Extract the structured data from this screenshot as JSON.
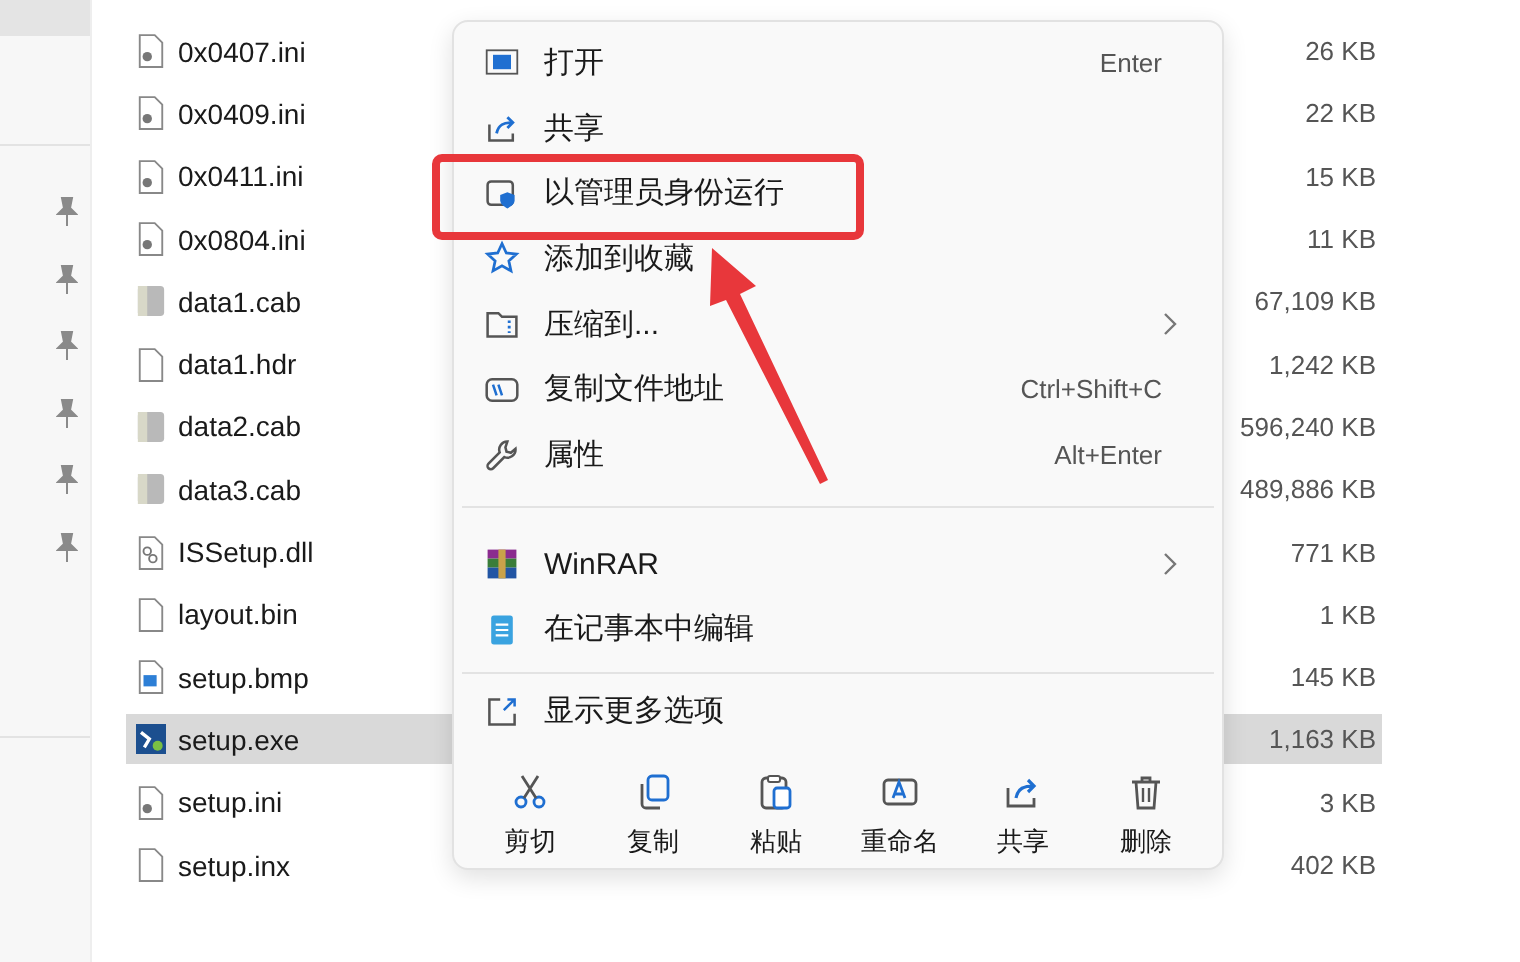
{
  "navigation_pane": {
    "pinned_items": [
      {
        "pinned": true
      },
      {
        "pinned": true
      },
      {
        "pinned": true
      },
      {
        "pinned": true
      },
      {
        "pinned": true
      },
      {
        "pinned": true
      }
    ]
  },
  "files": [
    {
      "name": "0x0407.ini",
      "size": "26 KB",
      "kind": "ini",
      "selected": false
    },
    {
      "name": "0x0409.ini",
      "size": "22 KB",
      "kind": "ini",
      "selected": false
    },
    {
      "name": "0x0411.ini",
      "size": "15 KB",
      "kind": "ini",
      "selected": false
    },
    {
      "name": "0x0804.ini",
      "size": "11 KB",
      "kind": "ini",
      "selected": false
    },
    {
      "name": "data1.cab",
      "size": "67,109 KB",
      "kind": "cab",
      "selected": false
    },
    {
      "name": "data1.hdr",
      "size": "1,242 KB",
      "kind": "blank",
      "selected": false
    },
    {
      "name": "data2.cab",
      "size": "596,240 KB",
      "kind": "cab",
      "selected": false
    },
    {
      "name": "data3.cab",
      "size": "489,886 KB",
      "kind": "cab",
      "selected": false
    },
    {
      "name": "ISSetup.dll",
      "size": "771 KB",
      "kind": "dll",
      "selected": false
    },
    {
      "name": "layout.bin",
      "size": "1 KB",
      "kind": "blank",
      "selected": false
    },
    {
      "name": "setup.bmp",
      "size": "145 KB",
      "kind": "bmp",
      "selected": false
    },
    {
      "name": "setup.exe",
      "size": "1,163 KB",
      "kind": "exe",
      "selected": true
    },
    {
      "name": "setup.ini",
      "size": "3 KB",
      "kind": "ini",
      "selected": false
    },
    {
      "name": "setup.inx",
      "size": "402 KB",
      "kind": "blank",
      "selected": false
    }
  ],
  "context_menu": {
    "groups": [
      [
        {
          "label": "打开",
          "shortcut": "Enter",
          "submenu": false
        },
        {
          "label": "共享",
          "submenu": false
        },
        {
          "label": "以管理员身份运行",
          "submenu": false
        },
        {
          "label": "添加到收藏",
          "submenu": false
        },
        {
          "label": "压缩到...",
          "submenu": true
        },
        {
          "label": "复制文件地址",
          "shortcut": "Ctrl+Shift+C",
          "submenu": false
        },
        {
          "label": "属性",
          "shortcut": "Alt+Enter",
          "submenu": false
        }
      ],
      [
        {
          "label": "WinRAR",
          "submenu": true
        },
        {
          "label": "在记事本中编辑",
          "submenu": false
        }
      ],
      [
        {
          "label": "显示更多选项",
          "submenu": false
        }
      ]
    ],
    "actions": [
      {
        "label": "剪切"
      },
      {
        "label": "复制"
      },
      {
        "label": "粘贴"
      },
      {
        "label": "重命名"
      },
      {
        "label": "共享"
      },
      {
        "label": "删除"
      }
    ]
  }
}
